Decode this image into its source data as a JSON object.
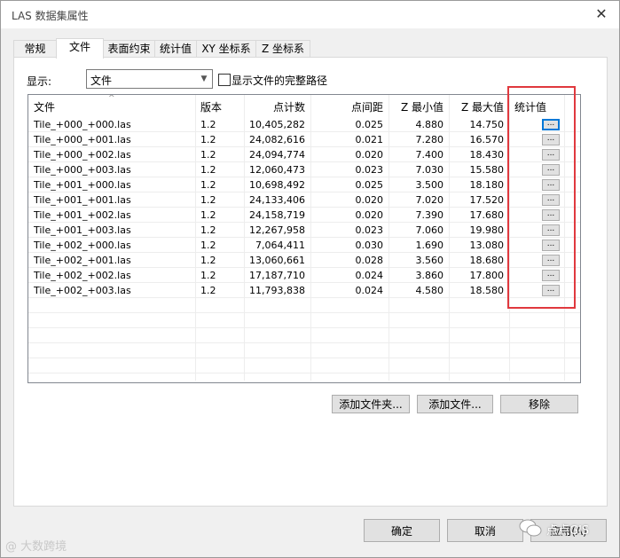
{
  "window": {
    "title": "LAS 数据集属性",
    "close_glyph": "✕"
  },
  "tabs": [
    {
      "label": "常规",
      "active": false
    },
    {
      "label": "文件",
      "active": true
    },
    {
      "label": "表面约束",
      "active": false
    },
    {
      "label": "统计值",
      "active": false
    },
    {
      "label": "XY 坐标系",
      "active": false
    },
    {
      "label": "Z 坐标系",
      "active": false
    }
  ],
  "display": {
    "label": "显示:",
    "selected": "文件",
    "checkbox_label": "显示文件的完整路径",
    "checkbox_checked": false
  },
  "table": {
    "sort_glyph": "^",
    "columns": [
      "文件",
      "版本",
      "点计数",
      "点间距",
      "Z 最小值",
      "Z 最大值",
      "统计值"
    ],
    "rows": [
      {
        "file": "Tile_+000_+000.las",
        "version": "1.2",
        "count": "10,405,282",
        "spacing": "0.025",
        "zmin": "4.880",
        "zmax": "14.750",
        "stats": "..."
      },
      {
        "file": "Tile_+000_+001.las",
        "version": "1.2",
        "count": "24,082,616",
        "spacing": "0.021",
        "zmin": "7.280",
        "zmax": "16.570",
        "stats": "..."
      },
      {
        "file": "Tile_+000_+002.las",
        "version": "1.2",
        "count": "24,094,774",
        "spacing": "0.020",
        "zmin": "7.400",
        "zmax": "18.430",
        "stats": "..."
      },
      {
        "file": "Tile_+000_+003.las",
        "version": "1.2",
        "count": "12,060,473",
        "spacing": "0.023",
        "zmin": "7.030",
        "zmax": "15.580",
        "stats": "..."
      },
      {
        "file": "Tile_+001_+000.las",
        "version": "1.2",
        "count": "10,698,492",
        "spacing": "0.025",
        "zmin": "3.500",
        "zmax": "18.180",
        "stats": "..."
      },
      {
        "file": "Tile_+001_+001.las",
        "version": "1.2",
        "count": "24,133,406",
        "spacing": "0.020",
        "zmin": "7.020",
        "zmax": "17.520",
        "stats": "..."
      },
      {
        "file": "Tile_+001_+002.las",
        "version": "1.2",
        "count": "24,158,719",
        "spacing": "0.020",
        "zmin": "7.390",
        "zmax": "17.680",
        "stats": "..."
      },
      {
        "file": "Tile_+001_+003.las",
        "version": "1.2",
        "count": "12,267,958",
        "spacing": "0.023",
        "zmin": "7.060",
        "zmax": "19.980",
        "stats": "..."
      },
      {
        "file": "Tile_+002_+000.las",
        "version": "1.2",
        "count": "7,064,411",
        "spacing": "0.030",
        "zmin": "1.690",
        "zmax": "13.080",
        "stats": "..."
      },
      {
        "file": "Tile_+002_+001.las",
        "version": "1.2",
        "count": "13,060,661",
        "spacing": "0.028",
        "zmin": "3.560",
        "zmax": "18.680",
        "stats": "..."
      },
      {
        "file": "Tile_+002_+002.las",
        "version": "1.2",
        "count": "17,187,710",
        "spacing": "0.024",
        "zmin": "3.860",
        "zmax": "17.800",
        "stats": "..."
      },
      {
        "file": "Tile_+002_+003.las",
        "version": "1.2",
        "count": "11,793,838",
        "spacing": "0.024",
        "zmin": "4.580",
        "zmax": "18.580",
        "stats": "..."
      }
    ]
  },
  "actions": {
    "add_folder": "添加文件夹...",
    "add_file": "添加文件...",
    "remove": "移除"
  },
  "footer": {
    "ok": "确定",
    "cancel": "取消",
    "apply": "应用(A)"
  },
  "annotation": {
    "color": "#e0393e"
  },
  "watermarks": {
    "left": "@ 大数跨境",
    "right": "点点GIS"
  }
}
